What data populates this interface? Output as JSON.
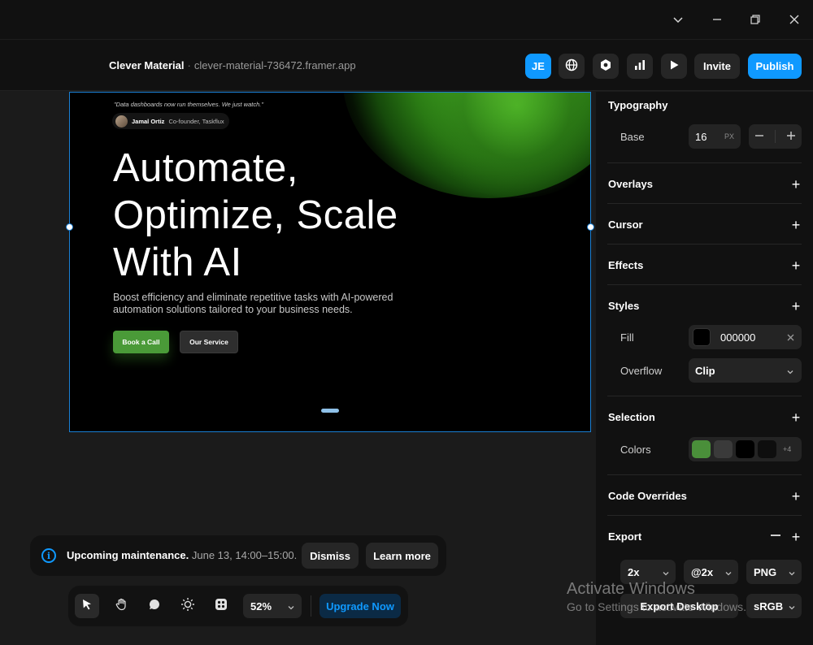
{
  "window": {
    "controls": [
      "chevron-down-icon",
      "minimize-icon",
      "restore-icon",
      "close-icon"
    ]
  },
  "header": {
    "project_name": "Clever Material",
    "separator": "·",
    "project_url": "clever-material-736472.framer.app",
    "avatar_initials": "JE",
    "invite_label": "Invite",
    "publish_label": "Publish",
    "accent_color": "#0f99ff"
  },
  "canvas": {
    "quote": "\"Data dashboards now run themselves. We just watch.\"",
    "author_name": "Jamal Ortiz",
    "author_role": "Co-founder, Taskflux",
    "headline_line1": "Automate,",
    "headline_line2": "Optimize, Scale",
    "headline_line3": "With AI",
    "subtitle": "Boost efficiency and eliminate repetitive tasks with AI-powered automation solutions tailored to your business needs.",
    "cta_primary": "Book a Call",
    "cta_secondary": "Our Service"
  },
  "panel": {
    "typography": {
      "title": "Typography",
      "base_label": "Base",
      "base_value": "16",
      "base_unit": "PX"
    },
    "overlays": {
      "title": "Overlays"
    },
    "cursor": {
      "title": "Cursor"
    },
    "effects": {
      "title": "Effects"
    },
    "styles": {
      "title": "Styles",
      "fill_label": "Fill",
      "fill_value": "000000",
      "fill_color": "#000000",
      "overflow_label": "Overflow",
      "overflow_value": "Clip"
    },
    "selection": {
      "title": "Selection",
      "colors_label": "Colors",
      "swatches": [
        "#4a8f3a",
        "#3a3a3a",
        "#000000",
        "#0e0e0e"
      ],
      "more_count": "+4"
    },
    "code_overrides": {
      "title": "Code Overrides"
    },
    "export": {
      "title": "Export",
      "scale": "2x",
      "suffix": "@2x",
      "format": "PNG",
      "export_button": "Export Desktop",
      "color_profile": "sRGB"
    }
  },
  "notice": {
    "title": "Upcoming maintenance.",
    "detail": "June 13, 14:00–15:00.",
    "dismiss_label": "Dismiss",
    "learn_more_label": "Learn more"
  },
  "toolbar": {
    "zoom": "52%",
    "upgrade_label": "Upgrade Now"
  },
  "watermark": {
    "line1": "Activate Windows",
    "line2": "Go to Settings to activate Windows."
  }
}
